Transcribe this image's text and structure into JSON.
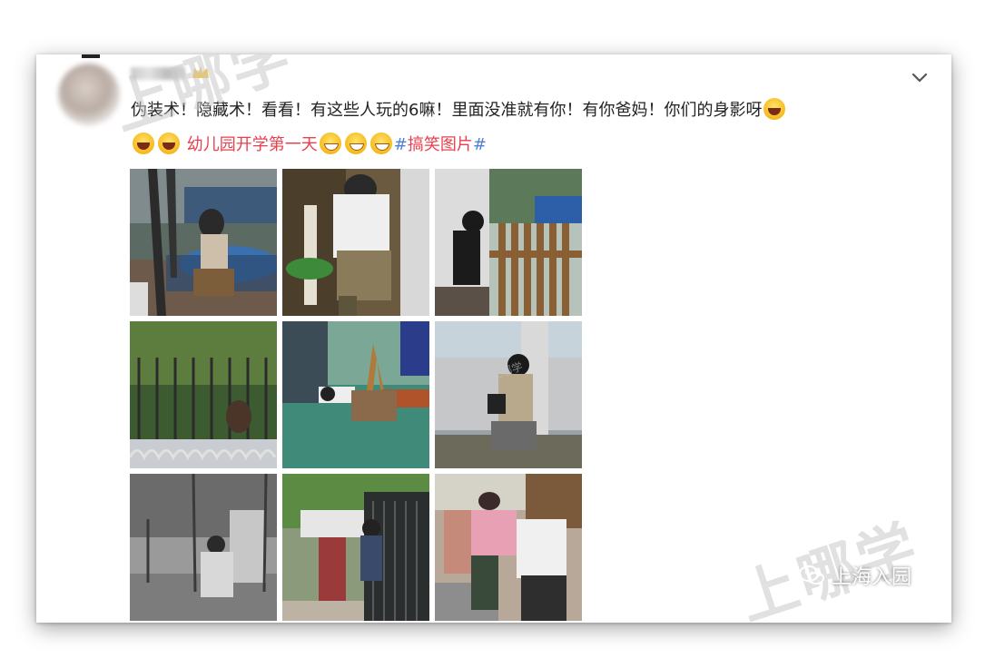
{
  "post": {
    "line1": "伪装术！隐藏术！看看！有这些人玩的6嘛！里面没准就有你！有你爸妈！你们的身影呀",
    "line2_topic": "幼儿园开学第一天",
    "line2_hash_open": "#",
    "line2_hashtag": "搞笑图片",
    "line2_hash_close": "#"
  },
  "icons": {
    "chevron": "chevron-down-icon",
    "vip": "vip-crown-icon",
    "emoji": "laughing-face-emoji",
    "wechat": "wechat-icon"
  },
  "watermark": {
    "large_top": "上哪学",
    "large_bottom": "上哪学",
    "small": "上哪学"
  },
  "brand": {
    "label": "上海入园"
  },
  "colors": {
    "topic_red": "#e8404e",
    "hashtag_blue": "#4f7fd6"
  }
}
